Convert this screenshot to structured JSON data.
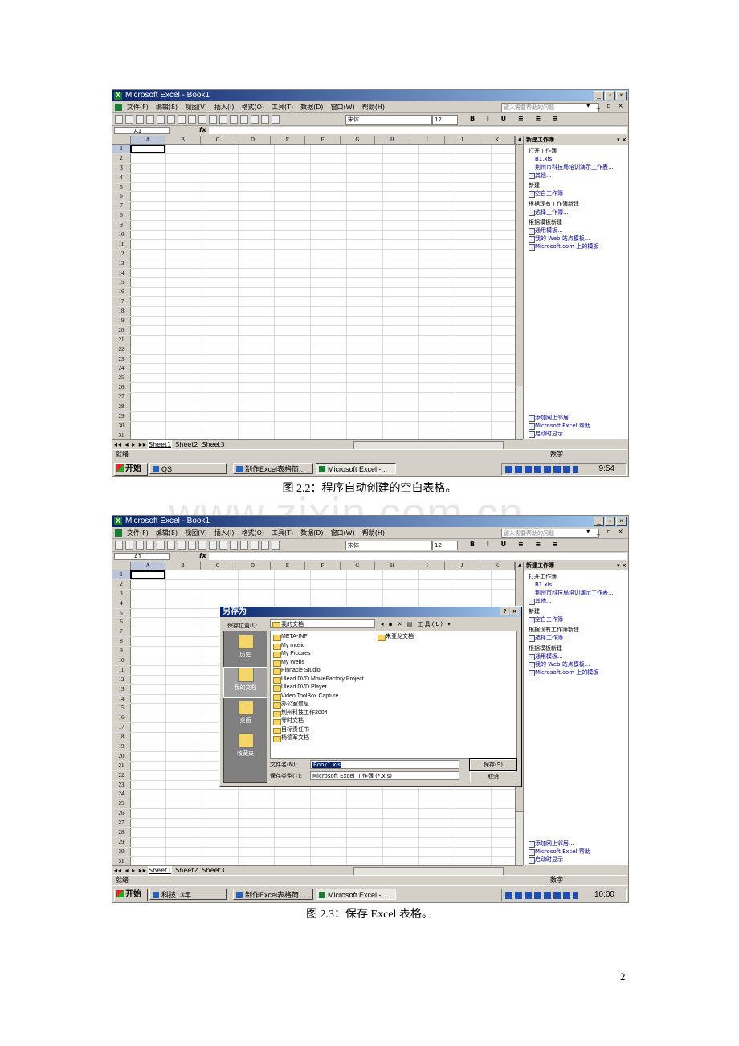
{
  "excel": {
    "window_title": "Microsoft Excel - Book1",
    "menu": [
      "文件(F)",
      "编辑(E)",
      "视图(V)",
      "插入(I)",
      "格式(O)",
      "工具(T)",
      "数据(D)",
      "窗口(W)",
      "帮助(H)"
    ],
    "help_placeholder": "键入需要帮助的问题",
    "font_name": "宋体",
    "font_size": "12",
    "name_box": "A1",
    "fx": "fx",
    "columns": [
      "A",
      "B",
      "C",
      "D",
      "E",
      "F",
      "G",
      "H",
      "I",
      "J",
      "K"
    ],
    "rows": [
      "1",
      "2",
      "3",
      "4",
      "5",
      "6",
      "7",
      "8",
      "9",
      "10",
      "11",
      "12",
      "13",
      "14",
      "15",
      "16",
      "17",
      "18",
      "19",
      "20",
      "21",
      "22",
      "23",
      "24",
      "25",
      "26",
      "27",
      "28",
      "29",
      "30",
      "31"
    ],
    "sheet_tabs": [
      "Sheet1",
      "Sheet2",
      "Sheet3"
    ],
    "status_ready": "就绪",
    "status_num": "数字",
    "start_label": "开始",
    "task_excel": "Microsoft Excel -...",
    "task_doc": "制作Excel表格简..."
  },
  "task_pane": {
    "title": "新建工作簿",
    "open_section": "打开工作簿",
    "recent": [
      "B1.xls",
      "荆州市科技局培训演示工作表..."
    ],
    "more": "其他...",
    "new_section": "新建",
    "blank": "空白工作簿",
    "from_existing_section": "根据现有工作簿新建",
    "choose": "选择工作簿...",
    "template_section": "根据模板新建",
    "general_templates": "通用模板...",
    "web_templates": "我的 Web 站点模板...",
    "ms_templates": "Microsoft.com 上的模板",
    "add_network": "添加网上邻居...",
    "help": "Microsoft Excel 帮助",
    "show_startup": "启动时显示"
  },
  "screenshot1": {
    "task_folder": "QS",
    "clock": "9:54",
    "caption": "图 2.2：程序自动创建的空白表格。"
  },
  "screenshot2": {
    "task_folder": "科技13年",
    "clock": "10:00",
    "caption": "图 2.3：保存 Excel 表格。"
  },
  "save_dialog": {
    "title": "另存为",
    "save_in_label": "保存位置(I):",
    "save_in_value": "我的文档",
    "tools": "工具(L)",
    "places": [
      "历史",
      "我的文档",
      "桌面",
      "收藏夹"
    ],
    "files_col1": [
      "META-INF",
      "My music",
      "My Pictures",
      "My Webs",
      "Pinnacle Studio",
      "Ulead DVD MovieFactory Project",
      "Ulead DVD Player",
      "Video ToolBox Capture",
      "办公室信息",
      "荆州科技工作2004",
      "零时文档",
      "目标责任书",
      "杨德军文档"
    ],
    "files_col2": [
      "朱亚龙文档"
    ],
    "filename_label": "文件名(N):",
    "filename_value": "Book1.xls",
    "filetype_label": "保存类型(T):",
    "filetype_value": "Microsoft Excel 工作簿 (*.xls)",
    "save_button": "保存(S)",
    "cancel_button": "取消"
  },
  "watermark": "www.zixin.com.cn",
  "page_number": "2"
}
